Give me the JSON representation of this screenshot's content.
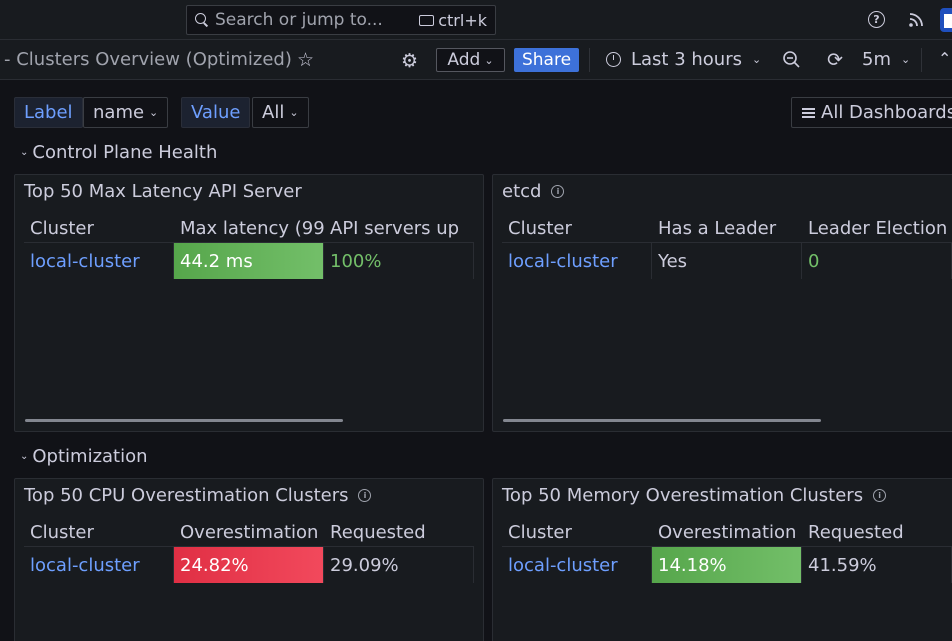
{
  "topbar": {
    "search_placeholder": "Search or jump to...",
    "search_shortcut": "ctrl+k"
  },
  "toolbar": {
    "breadcrumb": "- Clusters Overview (Optimized)",
    "add_label": "Add",
    "share_label": "Share",
    "time_range": "Last 3 hours",
    "refresh_interval": "5m"
  },
  "variables": [
    {
      "label": "Label",
      "value": "name"
    },
    {
      "label": "Value",
      "value": "All"
    }
  ],
  "all_dashboards_label": "All Dashboards",
  "rows": [
    {
      "title": "Control Plane Health"
    },
    {
      "title": "Optimization"
    }
  ],
  "panels": {
    "api": {
      "title": "Top 50 Max Latency API Server",
      "headers": [
        "Cluster",
        "Max latency (99",
        "API servers up"
      ],
      "rows": [
        [
          "local-cluster",
          "44.2 ms",
          "100%"
        ]
      ]
    },
    "etcd": {
      "title": "etcd",
      "headers": [
        "Cluster",
        "Has a Leader",
        "Leader Election"
      ],
      "rows": [
        [
          "local-cluster",
          "Yes",
          "0"
        ]
      ]
    },
    "cpu": {
      "title": "Top 50 CPU Overestimation Clusters",
      "headers": [
        "Cluster",
        "Overestimation",
        "Requested"
      ],
      "rows": [
        [
          "local-cluster",
          "24.82%",
          "29.09%"
        ]
      ]
    },
    "mem": {
      "title": "Top 50 Memory Overestimation Clusters",
      "headers": [
        "Cluster",
        "Overestimation",
        "Requested"
      ],
      "rows": [
        [
          "local-cluster",
          "14.18%",
          "41.59%"
        ]
      ]
    }
  },
  "colors": {
    "accent": "#3d71d9",
    "link": "#6e9fff",
    "ok": "#73bf69",
    "bad": "#f2495c"
  }
}
